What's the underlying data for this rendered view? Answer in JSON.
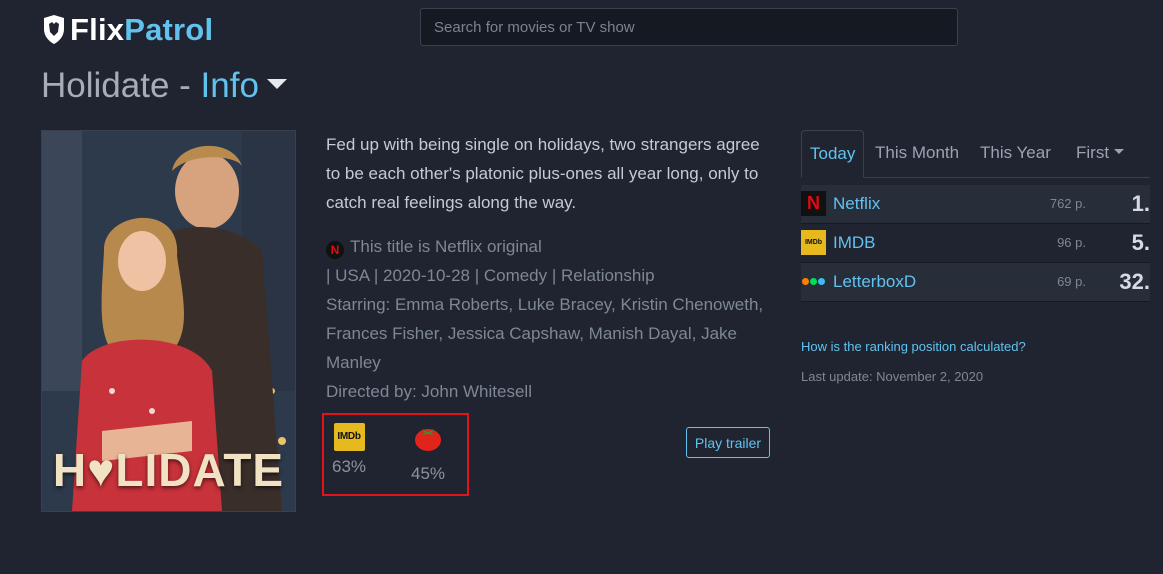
{
  "header": {
    "logo_part1": "Flix",
    "logo_part2": "Patrol",
    "search_placeholder": "Search for movies or TV show"
  },
  "title": {
    "name": "Holidate",
    "separator": "-",
    "section": "Info"
  },
  "poster": {
    "title_text": "H♥LIDATE"
  },
  "description": "Fed up with being single on holidays, two strangers agree to be each other's platonic plus-ones all year long, only to catch real feelings along the way.",
  "meta": {
    "original": "This title is Netflix original",
    "details": "| USA | 2020-10-28 | Comedy | Relationship",
    "starring": "Starring: Emma Roberts, Luke Bracey, Kristin Chenoweth, Frances Fisher, Jessica Capshaw, Manish Dayal, Jake Manley",
    "directed": "Directed by: John Whitesell"
  },
  "ratings": {
    "imdb_label": "IMDb",
    "imdb": "63%",
    "tomato": "45%"
  },
  "trailer_button": "Play trailer",
  "tabs": [
    {
      "label": "Today"
    },
    {
      "label": "This Month"
    },
    {
      "label": "This Year"
    },
    {
      "label": "First"
    }
  ],
  "rankings": [
    {
      "service": "Netflix",
      "points": "762 p.",
      "position": "1."
    },
    {
      "service": "IMDB",
      "points": "96 p.",
      "position": "5."
    },
    {
      "service": "LetterboxD",
      "points": "69 p.",
      "position": "32."
    }
  ],
  "icons": {
    "netflix_letter": "N",
    "imdb_text": "IMDb"
  },
  "calc_link": "How is the ranking position calculated?",
  "last_update": "Last update: November 2, 2020",
  "colors": {
    "accent": "#62c2ee",
    "background": "#1f2430",
    "highlight_border": "#e0141a",
    "imdb_yellow": "#e6b91e",
    "netflix_red": "#e50914"
  }
}
